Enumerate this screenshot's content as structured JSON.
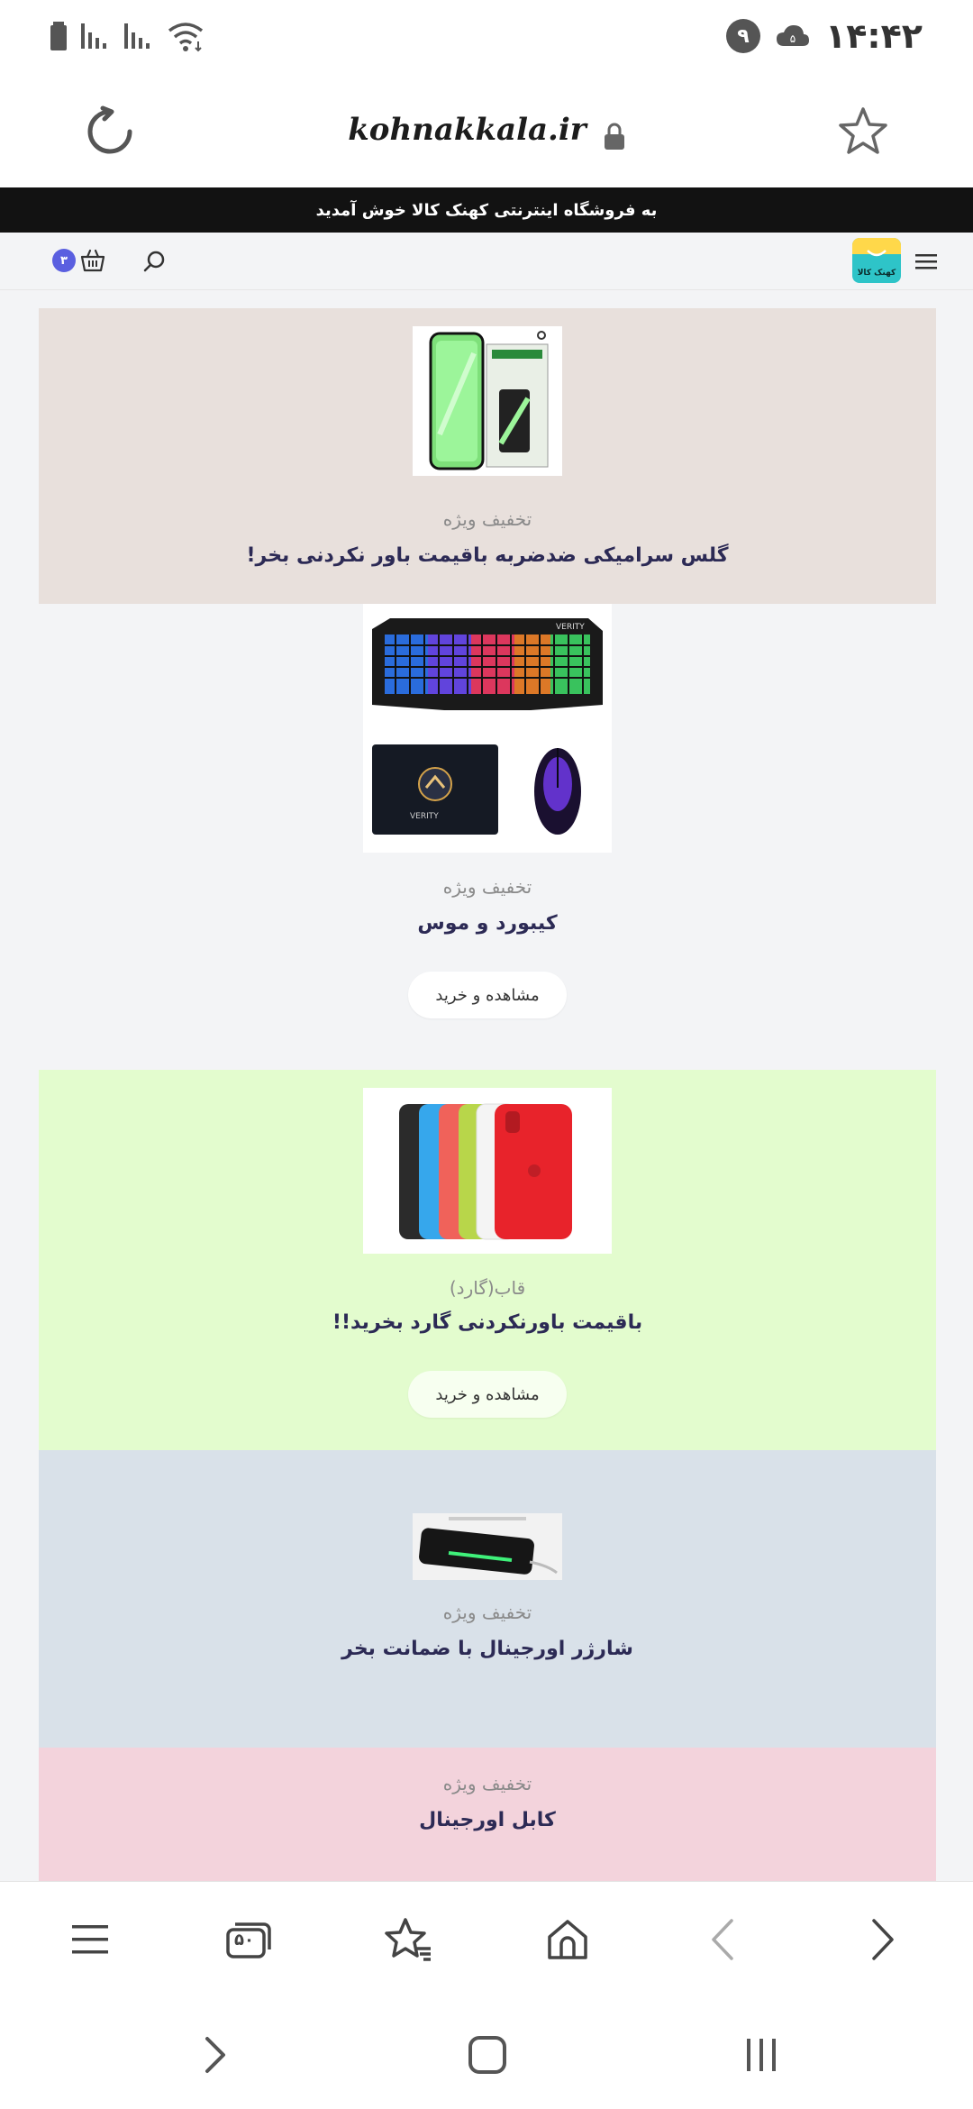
{
  "status_bar": {
    "time": "۱۴:۴۲",
    "notification_count": "۹"
  },
  "browser": {
    "url": "kohnakkala.ir",
    "tab_count": "۵۰"
  },
  "site": {
    "welcome_message": "به فروشگاه اینترنتی کهنک کالا خوش آمدید",
    "logo_text": "کهنک کالا",
    "cart_count": "۳"
  },
  "cards": [
    {
      "subtitle": "تخفیف ویژه",
      "title": "گلس سرامیکی ضدضربه باقیمت باور نکردنی بخر!",
      "background": "#e8e0dc"
    },
    {
      "subtitle": "تخفیف ویژه",
      "title": "کیبورد و موس",
      "button": "مشاهده و خرید",
      "background": "#f3f4f6"
    },
    {
      "subtitle": "قاب(گارد)",
      "title": "باقیمت باورنکردنی گارد بخرید!!",
      "button": "مشاهده و خرید",
      "background": "#e3fcce"
    },
    {
      "subtitle": "تخفیف ویژه",
      "title": "شارژر اورجینال با ضمانت بخر",
      "background": "#d9e1e9"
    },
    {
      "subtitle": "تخفیف ویژه",
      "title": "کابل اورجینال",
      "background": "#f3d3dc"
    }
  ],
  "colors": {
    "accent": "#5a5fe0",
    "banner": "#121212",
    "title_text": "#2c2a55"
  }
}
